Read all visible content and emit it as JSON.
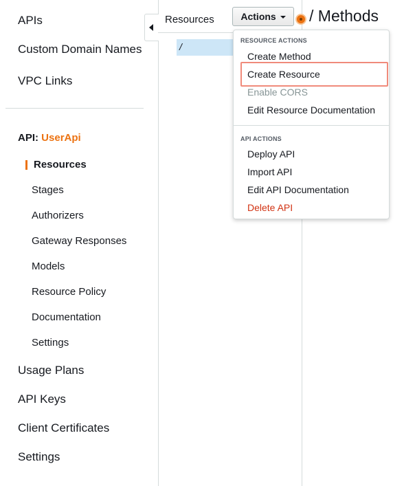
{
  "sidebar": {
    "top_items": [
      "APIs",
      "Custom Domain Names",
      "VPC Links"
    ],
    "api_prefix": "API:",
    "api_name": "UserApi",
    "sub_items": [
      "Resources",
      "Stages",
      "Authorizers",
      "Gateway Responses",
      "Models",
      "Resource Policy",
      "Documentation",
      "Settings"
    ],
    "bottom_items": [
      "Usage Plans",
      "API Keys",
      "Client Certificates",
      "Settings"
    ]
  },
  "resources": {
    "title": "Resources",
    "root_path": "/"
  },
  "toolbar": {
    "actions_label": "Actions"
  },
  "methods": {
    "title": "/ Methods"
  },
  "dropdown": {
    "resource_actions_header": "RESOURCE ACTIONS",
    "resource_actions": [
      "Create Method",
      "Create Resource",
      "Enable CORS",
      "Edit Resource Documentation"
    ],
    "api_actions_header": "API ACTIONS",
    "api_actions": [
      "Deploy API",
      "Import API",
      "Edit API Documentation",
      "Delete API"
    ]
  },
  "colors": {
    "accent": "#ec7211",
    "selected_bg": "#cde6f7",
    "danger": "#d13212",
    "highlight_border": "#f08a7a"
  }
}
